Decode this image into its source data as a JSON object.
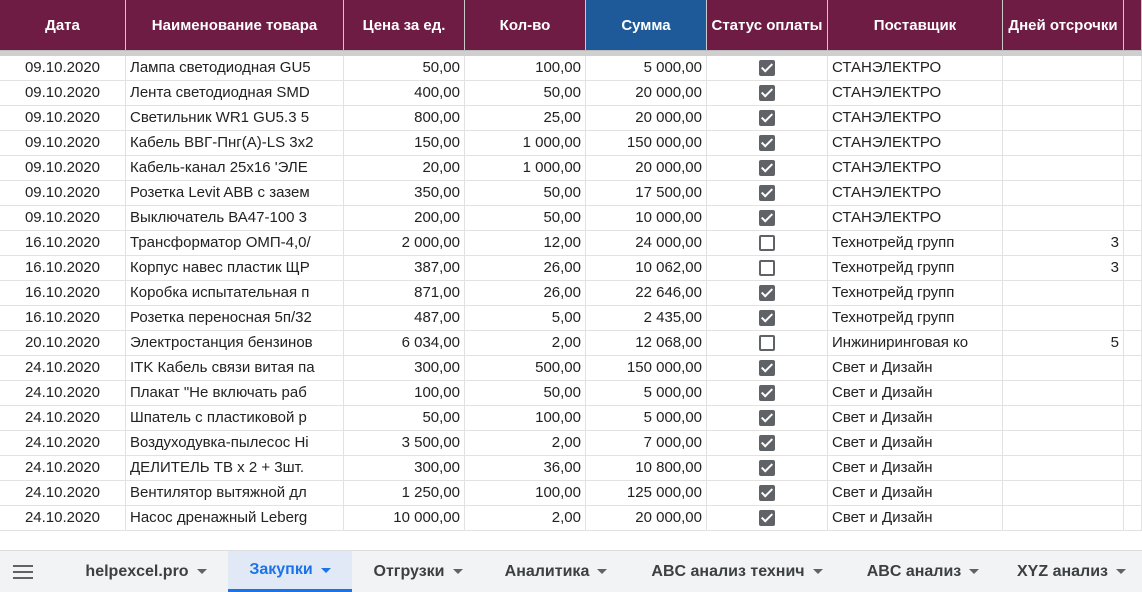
{
  "headers": [
    "Дата",
    "Наименование товара",
    "Цена за ед.",
    "Кол-во",
    "Сумма",
    "Статус оплаты",
    "Поставщик",
    "Дней отсрочки"
  ],
  "rows": [
    {
      "date": "09.10.2020",
      "name": "Лампа светодиодная GU5",
      "price": "50,00",
      "qty": "100,00",
      "sum": "5 000,00",
      "paid": true,
      "supplier": "СТАНЭЛЕКТРО",
      "days": ""
    },
    {
      "date": "09.10.2020",
      "name": "Лента светодиодная SMD",
      "price": "400,00",
      "qty": "50,00",
      "sum": "20 000,00",
      "paid": true,
      "supplier": "СТАНЭЛЕКТРО",
      "days": ""
    },
    {
      "date": "09.10.2020",
      "name": "Светильник WR1 GU5.3 5",
      "price": "800,00",
      "qty": "25,00",
      "sum": "20 000,00",
      "paid": true,
      "supplier": "СТАНЭЛЕКТРО",
      "days": ""
    },
    {
      "date": "09.10.2020",
      "name": "Кабель ВВГ-Пнг(А)-LS 3х2",
      "price": "150,00",
      "qty": "1 000,00",
      "sum": "150 000,00",
      "paid": true,
      "supplier": "СТАНЭЛЕКТРО",
      "days": ""
    },
    {
      "date": "09.10.2020",
      "name": "Кабель-канал 25х16 'ЭЛЕ",
      "price": "20,00",
      "qty": "1 000,00",
      "sum": "20 000,00",
      "paid": true,
      "supplier": "СТАНЭЛЕКТРО",
      "days": ""
    },
    {
      "date": "09.10.2020",
      "name": "Розетка Levit ABB с зазем",
      "price": "350,00",
      "qty": "50,00",
      "sum": "17 500,00",
      "paid": true,
      "supplier": "СТАНЭЛЕКТРО",
      "days": ""
    },
    {
      "date": "09.10.2020",
      "name": "Выключатель ВА47-100 3",
      "price": "200,00",
      "qty": "50,00",
      "sum": "10 000,00",
      "paid": true,
      "supplier": "СТАНЭЛЕКТРО",
      "days": ""
    },
    {
      "date": "16.10.2020",
      "name": "Трансформатор ОМП-4,0/",
      "price": "2 000,00",
      "qty": "12,00",
      "sum": "24 000,00",
      "paid": false,
      "supplier": "Технотрейд групп",
      "days": "3"
    },
    {
      "date": "16.10.2020",
      "name": "Корпус навес пластик ЩР",
      "price": "387,00",
      "qty": "26,00",
      "sum": "10 062,00",
      "paid": false,
      "supplier": "Технотрейд групп",
      "days": "3"
    },
    {
      "date": "16.10.2020",
      "name": "Коробка испытательная п",
      "price": "871,00",
      "qty": "26,00",
      "sum": "22 646,00",
      "paid": true,
      "supplier": "Технотрейд групп",
      "days": ""
    },
    {
      "date": "16.10.2020",
      "name": "Розетка переносная 5п/32",
      "price": "487,00",
      "qty": "5,00",
      "sum": "2 435,00",
      "paid": true,
      "supplier": "Технотрейд групп",
      "days": ""
    },
    {
      "date": "20.10.2020",
      "name": "Электростанция бензинов",
      "price": "6 034,00",
      "qty": "2,00",
      "sum": "12 068,00",
      "paid": false,
      "supplier": "Инжиниринговая ко",
      "days": "5"
    },
    {
      "date": "24.10.2020",
      "name": "ITK Кабель связи витая па",
      "price": "300,00",
      "qty": "500,00",
      "sum": "150 000,00",
      "paid": true,
      "supplier": "Свет и Дизайн",
      "days": ""
    },
    {
      "date": "24.10.2020",
      "name": "Плакат \"Не включать раб",
      "price": "100,00",
      "qty": "50,00",
      "sum": "5 000,00",
      "paid": true,
      "supplier": "Свет и Дизайн",
      "days": ""
    },
    {
      "date": "24.10.2020",
      "name": "Шпатель с пластиковой р",
      "price": "50,00",
      "qty": "100,00",
      "sum": "5 000,00",
      "paid": true,
      "supplier": "Свет и Дизайн",
      "days": ""
    },
    {
      "date": "24.10.2020",
      "name": "Воздуходувка-пылесос Hi",
      "price": "3 500,00",
      "qty": "2,00",
      "sum": "7 000,00",
      "paid": true,
      "supplier": "Свет и Дизайн",
      "days": ""
    },
    {
      "date": "24.10.2020",
      "name": "ДЕЛИТЕЛЬ ТВ х 2 + 3шт.",
      "price": "300,00",
      "qty": "36,00",
      "sum": "10 800,00",
      "paid": true,
      "supplier": "Свет и Дизайн",
      "days": ""
    },
    {
      "date": "24.10.2020",
      "name": "Вентилятор вытяжной дл",
      "price": "1 250,00",
      "qty": "100,00",
      "sum": "125 000,00",
      "paid": true,
      "supplier": "Свет и Дизайн",
      "days": ""
    },
    {
      "date": "24.10.2020",
      "name": "Насос дренажный Leberg",
      "price": "10 000,00",
      "qty": "2,00",
      "sum": "20 000,00",
      "paid": true,
      "supplier": "Свет и Дизайн",
      "days": ""
    }
  ],
  "tabs": [
    {
      "label": "helpexcel.pro",
      "active": false
    },
    {
      "label": "Закупки",
      "active": true
    },
    {
      "label": "Отгрузки",
      "active": false
    },
    {
      "label": "Аналитика",
      "active": false
    },
    {
      "label": "ABC анализ технич",
      "active": false
    },
    {
      "label": "ABC анализ",
      "active": false
    },
    {
      "label": "XYZ анализ",
      "active": false
    }
  ],
  "colors": {
    "header_bg": "#6f1c45",
    "sum_header_bg": "#1e5a9a",
    "active_tab": "#1a73e8"
  }
}
